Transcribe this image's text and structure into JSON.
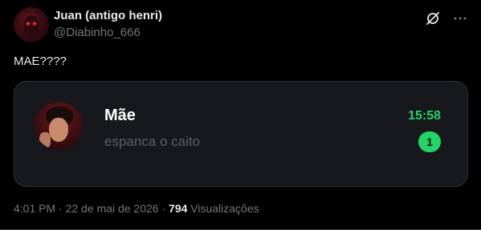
{
  "author": {
    "display_name": "Juan (antigo henri)",
    "handle": "@Diabinho_666"
  },
  "header_icons": [
    "grok-icon",
    "more-icon"
  ],
  "tweet": {
    "text": "MAE????"
  },
  "chat_card": {
    "contact_name": "Mãe",
    "last_message": "espanca o caito",
    "time": "15:58",
    "unread_count": "1",
    "accent_color": "#25d366"
  },
  "meta": {
    "time": "4:01 PM",
    "separator": "·",
    "date": "22 de mai de 2026",
    "views_count": "794",
    "views_label": "Visualizações"
  },
  "colors": {
    "background": "#000000",
    "card_background": "#16181c",
    "muted_text": "#71767b",
    "primary_text": "#e7e9ea"
  }
}
